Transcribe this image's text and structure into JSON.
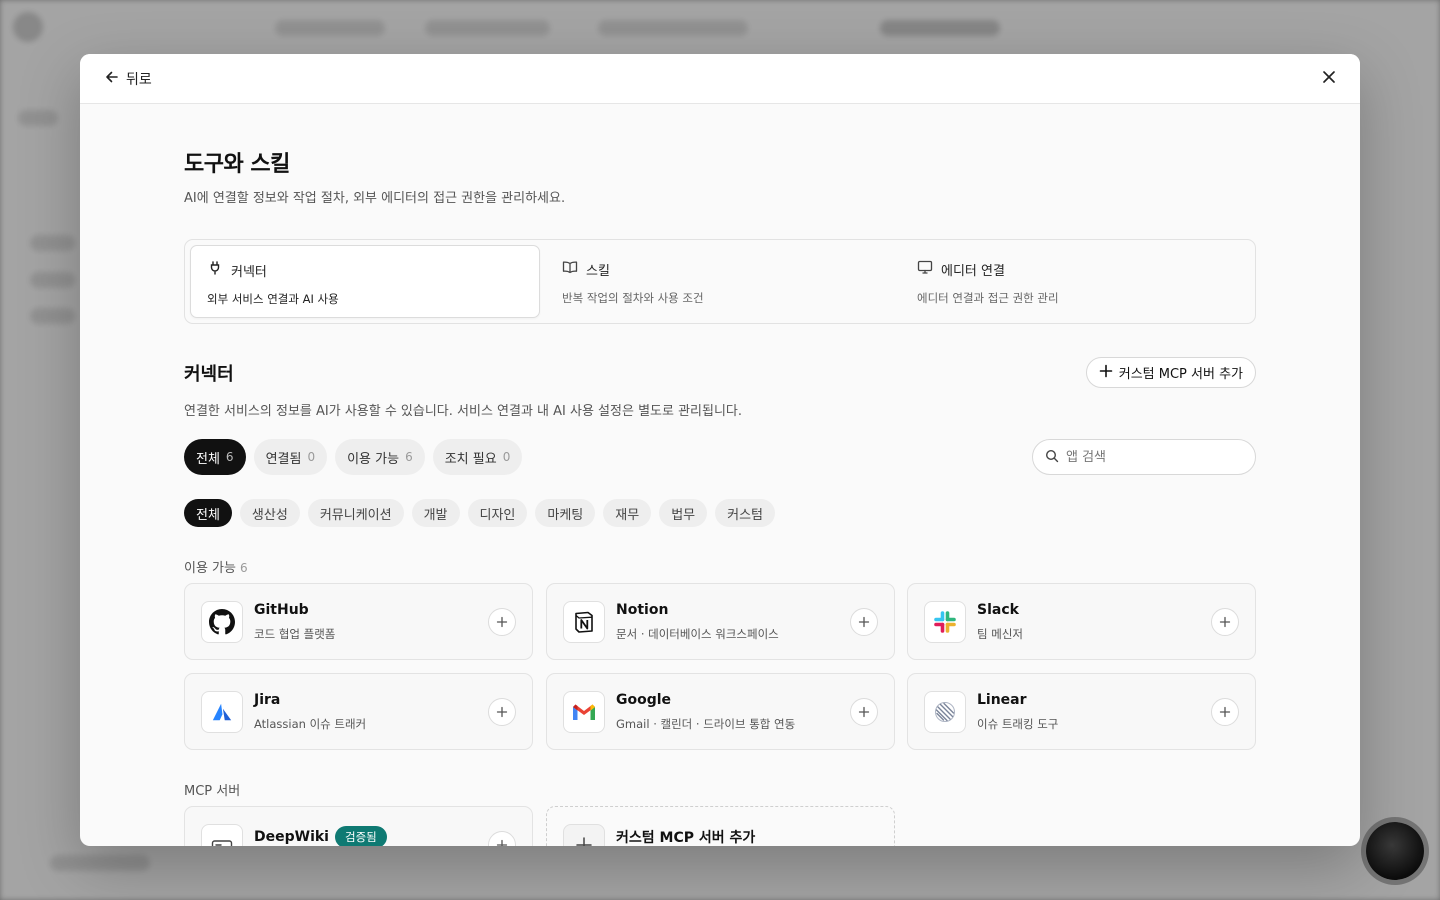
{
  "header": {
    "back_label": "뒤로"
  },
  "page": {
    "title": "도구와 스킬",
    "subtitle": "AI에 연결할 정보와 작업 절차, 외부 에디터의 접근 권한을 관리하세요."
  },
  "tabs": [
    {
      "label": "커넥터",
      "desc": "외부 서비스 연결과 AI 사용",
      "icon": "plug-icon",
      "active": true
    },
    {
      "label": "스킬",
      "desc": "반복 작업의 절차와 사용 조건",
      "icon": "book-icon",
      "active": false
    },
    {
      "label": "에디터 연결",
      "desc": "에디터 연결과 접근 권한 관리",
      "icon": "monitor-icon",
      "active": false
    }
  ],
  "section": {
    "title": "커넥터",
    "desc": "연결한 서비스의 정보를 AI가 사용할 수 있습니다. 서비스 연결과 내 AI 사용 설정은 별도로 관리됩니다.",
    "add_button": "커스텀 MCP 서버 추가"
  },
  "status_filters": [
    {
      "label": "전체",
      "count": "6",
      "active": true
    },
    {
      "label": "연결됨",
      "count": "0",
      "active": false
    },
    {
      "label": "이용 가능",
      "count": "6",
      "active": false
    },
    {
      "label": "조치 필요",
      "count": "0",
      "active": false
    }
  ],
  "search": {
    "placeholder": "앱 검색",
    "value": ""
  },
  "categories": [
    {
      "label": "전체",
      "active": true
    },
    {
      "label": "생산성",
      "active": false
    },
    {
      "label": "커뮤니케이션",
      "active": false
    },
    {
      "label": "개발",
      "active": false
    },
    {
      "label": "디자인",
      "active": false
    },
    {
      "label": "마케팅",
      "active": false
    },
    {
      "label": "재무",
      "active": false
    },
    {
      "label": "법무",
      "active": false
    },
    {
      "label": "커스텀",
      "active": false
    }
  ],
  "available": {
    "label": "이용 가능",
    "count": "6",
    "apps": [
      {
        "name": "GitHub",
        "desc": "코드 협업 플랫폼",
        "icon": "github-icon"
      },
      {
        "name": "Notion",
        "desc": "문서 · 데이터베이스 워크스페이스",
        "icon": "notion-icon"
      },
      {
        "name": "Slack",
        "desc": "팀 메신저",
        "icon": "slack-icon"
      },
      {
        "name": "Jira",
        "desc": "Atlassian 이슈 트래커",
        "icon": "jira-icon"
      },
      {
        "name": "Google",
        "desc": "Gmail · 캘린더 · 드라이브 통합 연동",
        "icon": "gmail-icon"
      },
      {
        "name": "Linear",
        "desc": "이슈 트래킹 도구",
        "icon": "linear-icon"
      }
    ]
  },
  "mcp": {
    "label": "MCP 서버",
    "servers": [
      {
        "name": "DeepWiki",
        "badge": "검증됨",
        "icon": "server-icon"
      }
    ],
    "add_card_label": "커스텀 MCP 서버 추가"
  },
  "colors": {
    "accent": "#111111",
    "verified_badge": "#0f7a73"
  }
}
